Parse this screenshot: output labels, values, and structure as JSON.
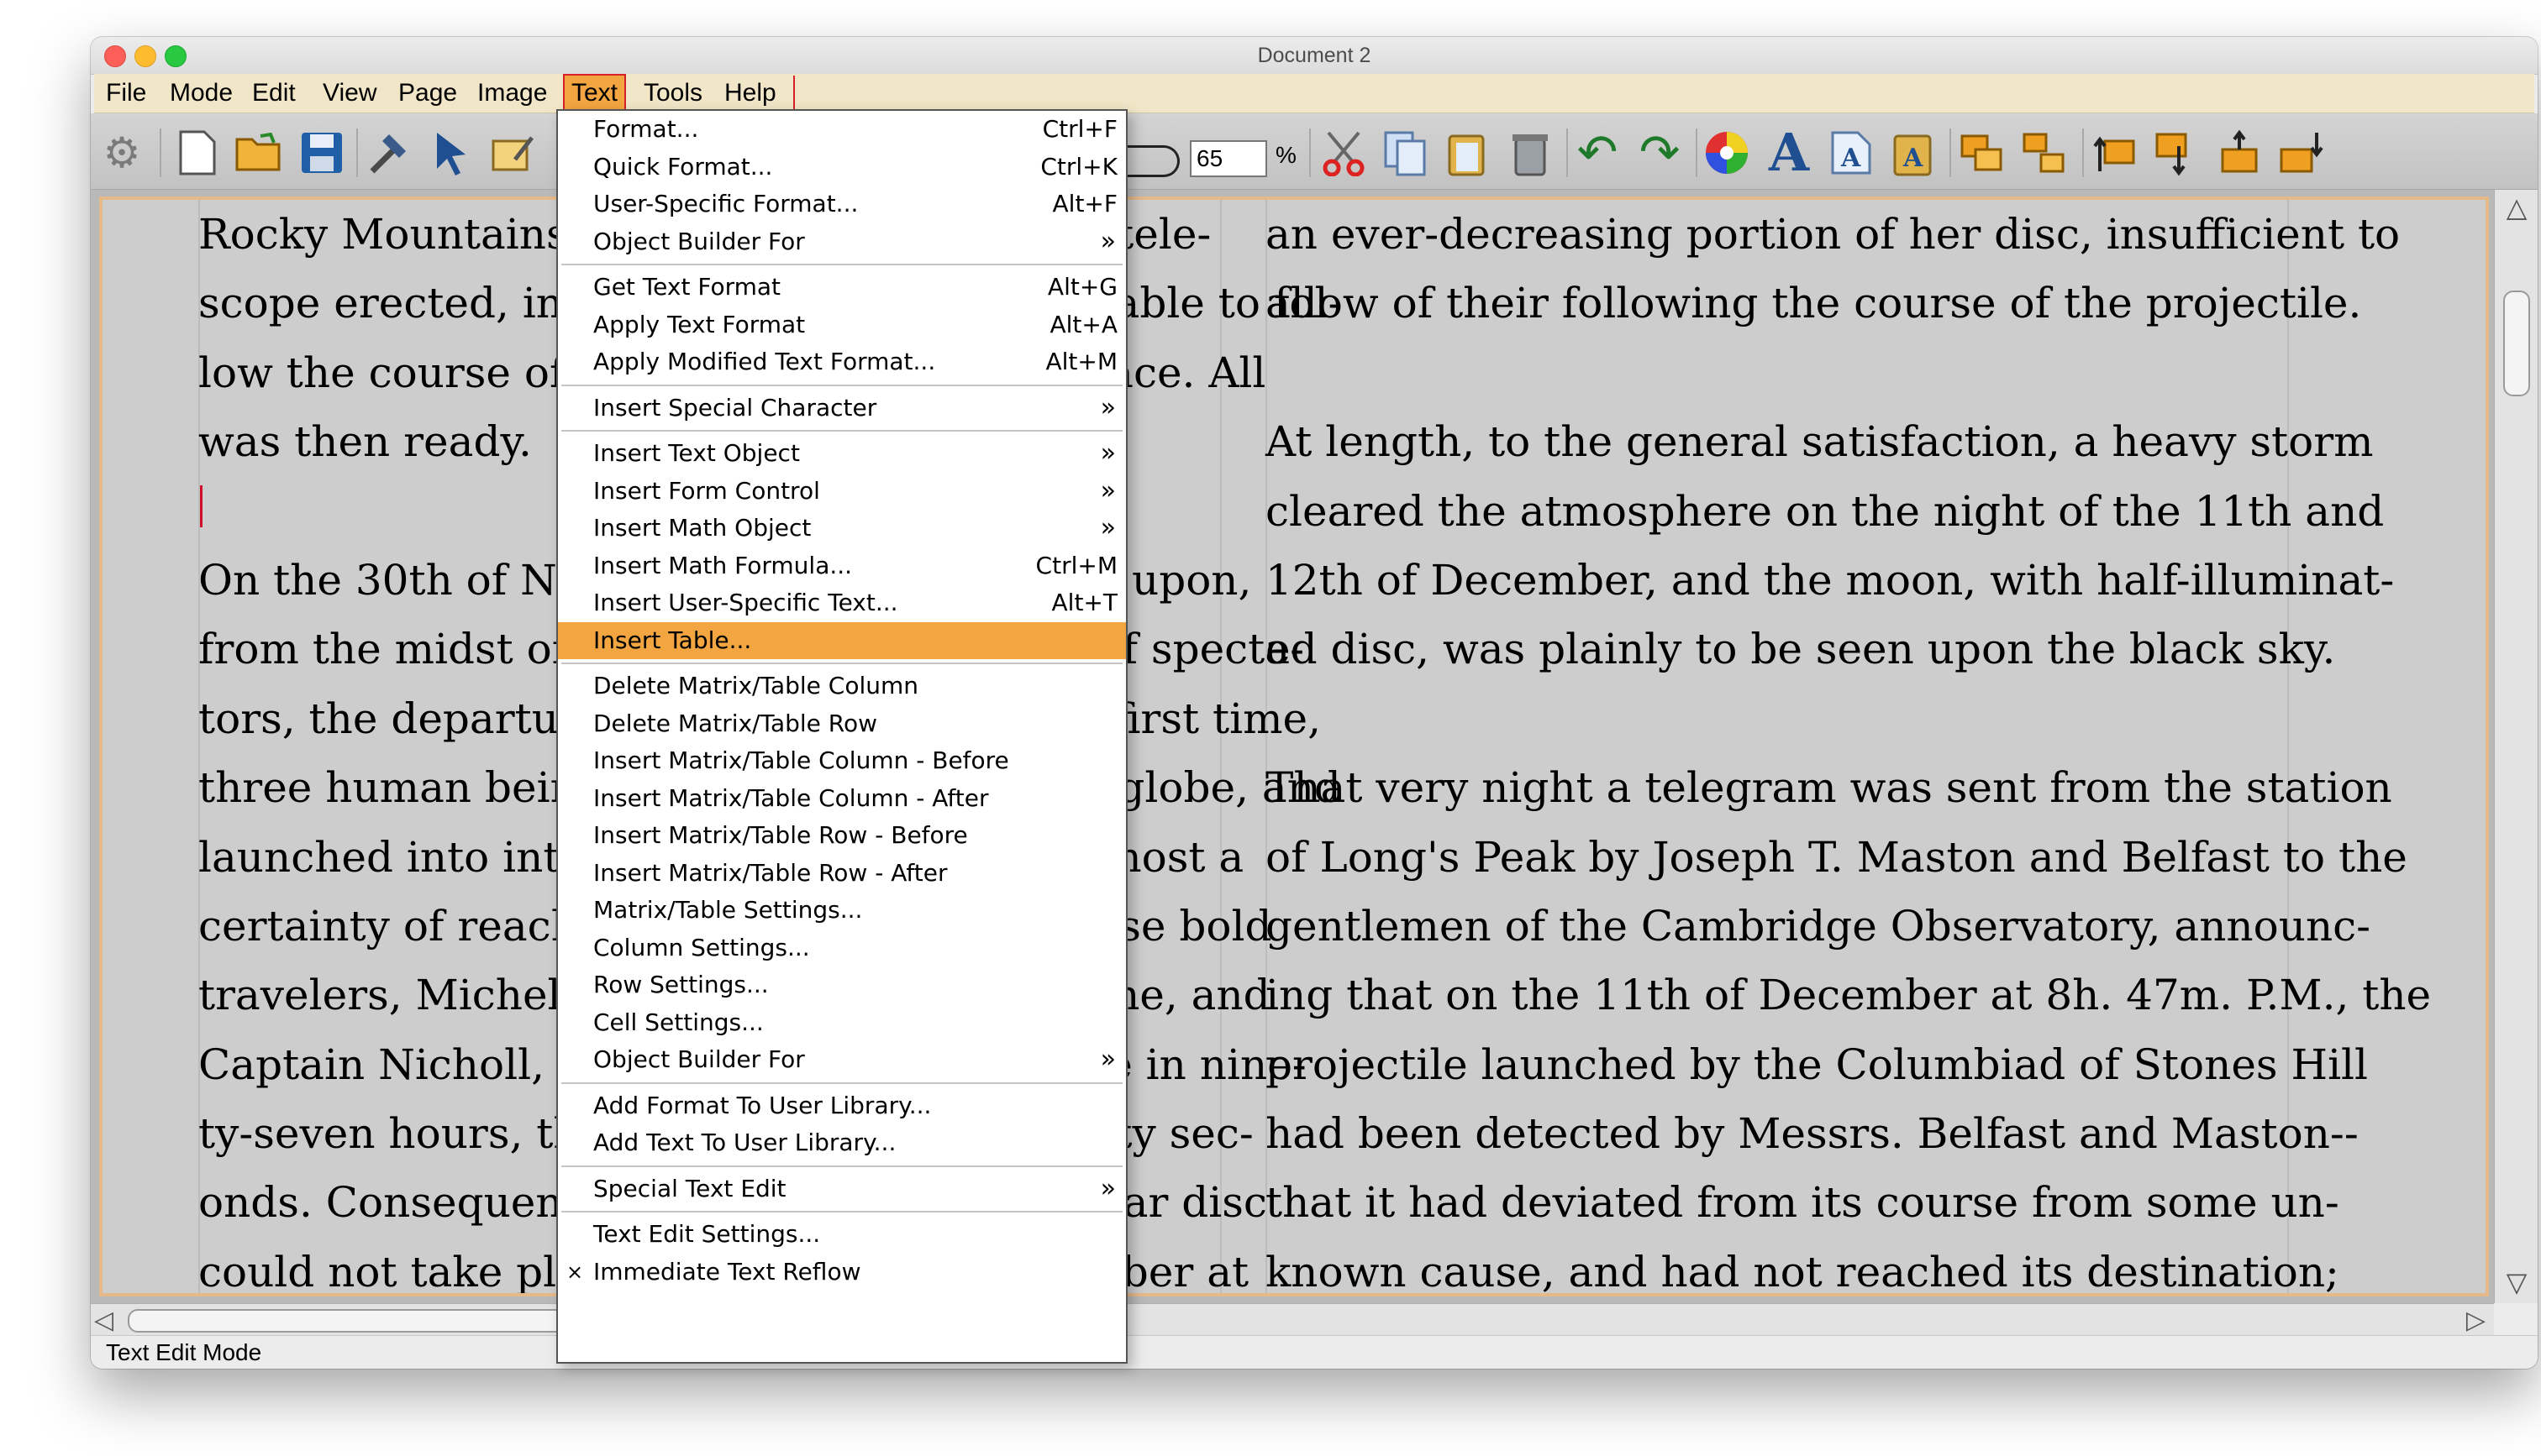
{
  "window": {
    "title": "Document 2"
  },
  "menubar": [
    "File",
    "Mode",
    "Edit",
    "View",
    "Page",
    "Image",
    "Text",
    "Tools",
    "Help"
  ],
  "toolbar": {
    "zoom_value": "65",
    "zoom_unit": "%",
    "icons": [
      "gear-icon",
      "new-document-icon",
      "open-folder-icon",
      "save-icon",
      "hammer-icon",
      "select-arrow-icon",
      "edit-text-icon",
      "scissors-icon",
      "copy-icon",
      "paste-icon",
      "trash-icon",
      "undo-icon",
      "redo-icon",
      "color-wheel-icon",
      "text-a-icon",
      "text-frame-icon",
      "text-frame-alt-icon",
      "group-icon",
      "ungroup-icon",
      "raise-icon",
      "lower-icon",
      "bring-front-icon",
      "send-back-icon"
    ]
  },
  "document": {
    "left_column": [
      "Rocky Mountains, that they had a gigantic tele-",
      "scope erected, in order that they might be able to fol-",
      "low the course of the projectile through space. All",
      "was then ready.",
      "",
      "On the 30th of November, at the hour fixed upon,",
      "from the midst of an extraordinary crowd of specta-",
      "tors, the departure took place, and for the first time,",
      "three human beings quitted the terrestrial globe, and",
      "launched into interplanetary space with almost a",
      "certainty of reaching their destination. These bold",
      "travelers, Michel Ardan, President Barbicane, and",
      "Captain Nicholl, ought to make the passage in nine-",
      "ty-seven hours, thirteen minutes, and twenty sec-",
      "onds. Consequently, their arrival on the lunar disc",
      "could not take place until the 5th of December at"
    ],
    "right_column": [
      "an ever-decreasing portion of her disc, insufficient to",
      "allow of their following the course of the projectile.",
      "",
      "At length, to the general satisfaction, a heavy storm",
      "cleared the atmosphere on the night of the 11th and",
      "12th of December, and the moon, with half-illuminat-",
      "ed disc, was plainly to be seen upon the black sky.",
      "",
      "That very night a telegram was sent from the station",
      "of Long's Peak by Joseph T. Maston and Belfast to the",
      "gentlemen of the Cambridge Observatory, announc-",
      "ing that on the 11th of December at 8h. 47m. P.M., the",
      "projectile launched by the Columbiad of Stones Hill",
      "had been detected by Messrs. Belfast and Maston--",
      "that it had deviated from its course from some un-",
      "known cause, and had not reached its destination;"
    ]
  },
  "text_menu": {
    "items": [
      {
        "label": "Format...",
        "shortcut": "Ctrl+F"
      },
      {
        "label": "Quick Format...",
        "shortcut": "Ctrl+K"
      },
      {
        "label": "User-Specific Format...",
        "shortcut": "Alt+F"
      },
      {
        "label": "Object Builder For",
        "submenu": "»"
      },
      {
        "separator": true
      },
      {
        "label": "Get Text Format",
        "shortcut": "Alt+G"
      },
      {
        "label": "Apply Text Format",
        "shortcut": "Alt+A"
      },
      {
        "label": "Apply Modified Text Format...",
        "shortcut": "Alt+M"
      },
      {
        "separator": true
      },
      {
        "label": "Insert Special Character",
        "submenu": "»"
      },
      {
        "separator": true
      },
      {
        "label": "Insert Text Object",
        "submenu": "»"
      },
      {
        "label": "Insert Form Control",
        "submenu": "»"
      },
      {
        "label": "Insert Math Object",
        "submenu": "»"
      },
      {
        "label": "Insert Math Formula...",
        "shortcut": "Ctrl+M"
      },
      {
        "label": "Insert User-Specific Text...",
        "shortcut": "Alt+T"
      },
      {
        "label": "Insert Table...",
        "highlighted": true
      },
      {
        "separator": true
      },
      {
        "label": "Delete Matrix/Table Column"
      },
      {
        "label": "Delete Matrix/Table Row"
      },
      {
        "label": "Insert Matrix/Table Column - Before"
      },
      {
        "label": "Insert Matrix/Table Column - After"
      },
      {
        "label": "Insert Matrix/Table Row - Before"
      },
      {
        "label": "Insert Matrix/Table Row - After"
      },
      {
        "label": "Matrix/Table Settings..."
      },
      {
        "label": "Column Settings..."
      },
      {
        "label": "Row Settings..."
      },
      {
        "label": "Cell Settings..."
      },
      {
        "label": "Object Builder For",
        "submenu": "»"
      },
      {
        "separator": true
      },
      {
        "label": "Add Format To User Library..."
      },
      {
        "label": "Add Text To User Library..."
      },
      {
        "separator": true
      },
      {
        "label": "Special Text Edit",
        "submenu": "»"
      },
      {
        "separator": true
      },
      {
        "label": "Text Edit Settings..."
      },
      {
        "label": "Immediate Text Reflow",
        "check": "×"
      }
    ]
  },
  "status": {
    "text": "Text Edit Mode"
  }
}
